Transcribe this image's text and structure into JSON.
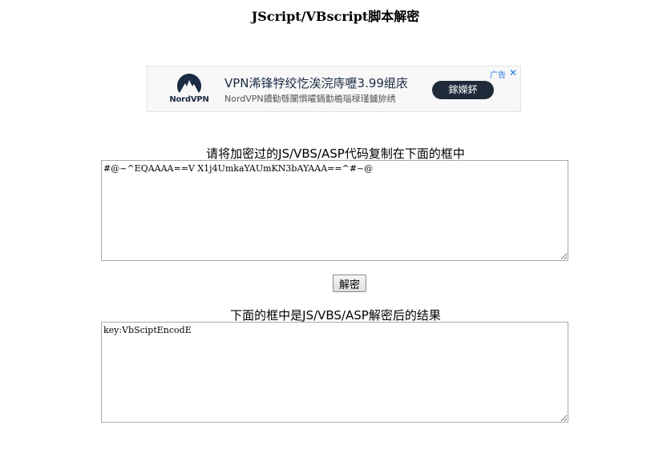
{
  "page": {
    "title": "JScript/VBscript脚本解密"
  },
  "ad": {
    "brand": "NordVPN",
    "headline": "VPN浠锋牸绞忔涘浣庤嚦3.99绲庡",
    "description": "NordVPN鐨勬綔闃惧皬鍋勫槝瑙椂瑾鐪旀绣",
    "cta_label": "鎵嬫鈈",
    "ad_label": "广告",
    "close_glyph": "✕"
  },
  "input_section": {
    "label": "请将加密过的JS/VBS/ASP代码复制在下面的框中",
    "value": "#@~^EQAAAA==V X1j4UmkaYAUmKN3bAYAAA==^#~@"
  },
  "decrypt_button": {
    "label": "解密"
  },
  "output_section": {
    "label": "下面的框中是JS/VBS/ASP解密后的结果",
    "value": "key:VbSciptEncodE"
  }
}
